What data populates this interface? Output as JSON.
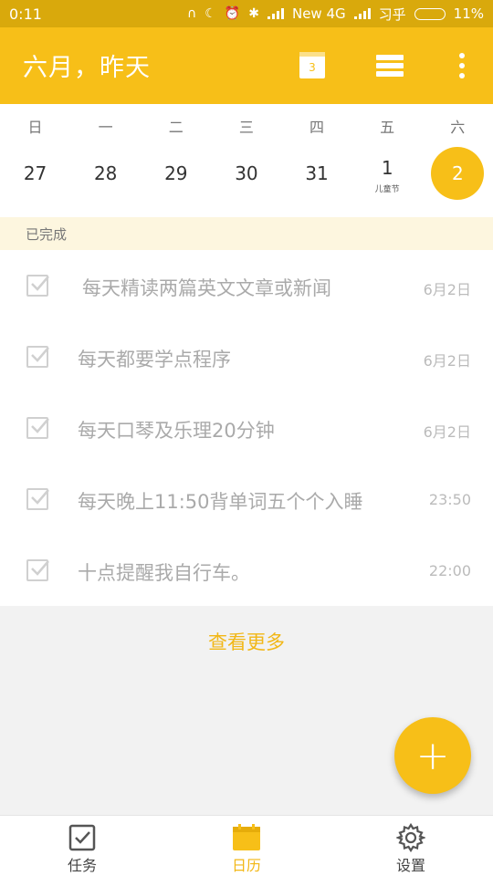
{
  "status_bar": {
    "time": "0:11",
    "network": "New 4G",
    "app": "习乎",
    "battery": "11%"
  },
  "app_bar": {
    "title": "六月，昨天",
    "calendar_day": "3",
    "accent_color": "#f7bf18"
  },
  "week": {
    "weekdays": [
      "日",
      "一",
      "二",
      "三",
      "四",
      "五",
      "六"
    ],
    "dates": [
      "27",
      "28",
      "29",
      "30",
      "31",
      "1",
      "2"
    ],
    "holiday_label": "儿童节",
    "selected": "2"
  },
  "section": {
    "completed_label": "已完成"
  },
  "tasks": [
    {
      "title": "每天精读两篇英文文章或新闻",
      "date": "6月2日"
    },
    {
      "title": "每天都要学点程序",
      "date": "6月2日"
    },
    {
      "title": "每天口琴及乐理20分钟",
      "date": "6月2日"
    },
    {
      "title": "每天晚上11:50背单词五个个入睡",
      "date": "23:50"
    },
    {
      "title": "十点提醒我自行车。",
      "date": "22:00"
    }
  ],
  "more_label": "查看更多",
  "fab_label": "+",
  "bottom_nav": [
    {
      "label": "任务",
      "icon": "checkbox-icon"
    },
    {
      "label": "日历",
      "icon": "calendar-icon",
      "active": true
    },
    {
      "label": "设置",
      "icon": "gear-icon"
    }
  ]
}
